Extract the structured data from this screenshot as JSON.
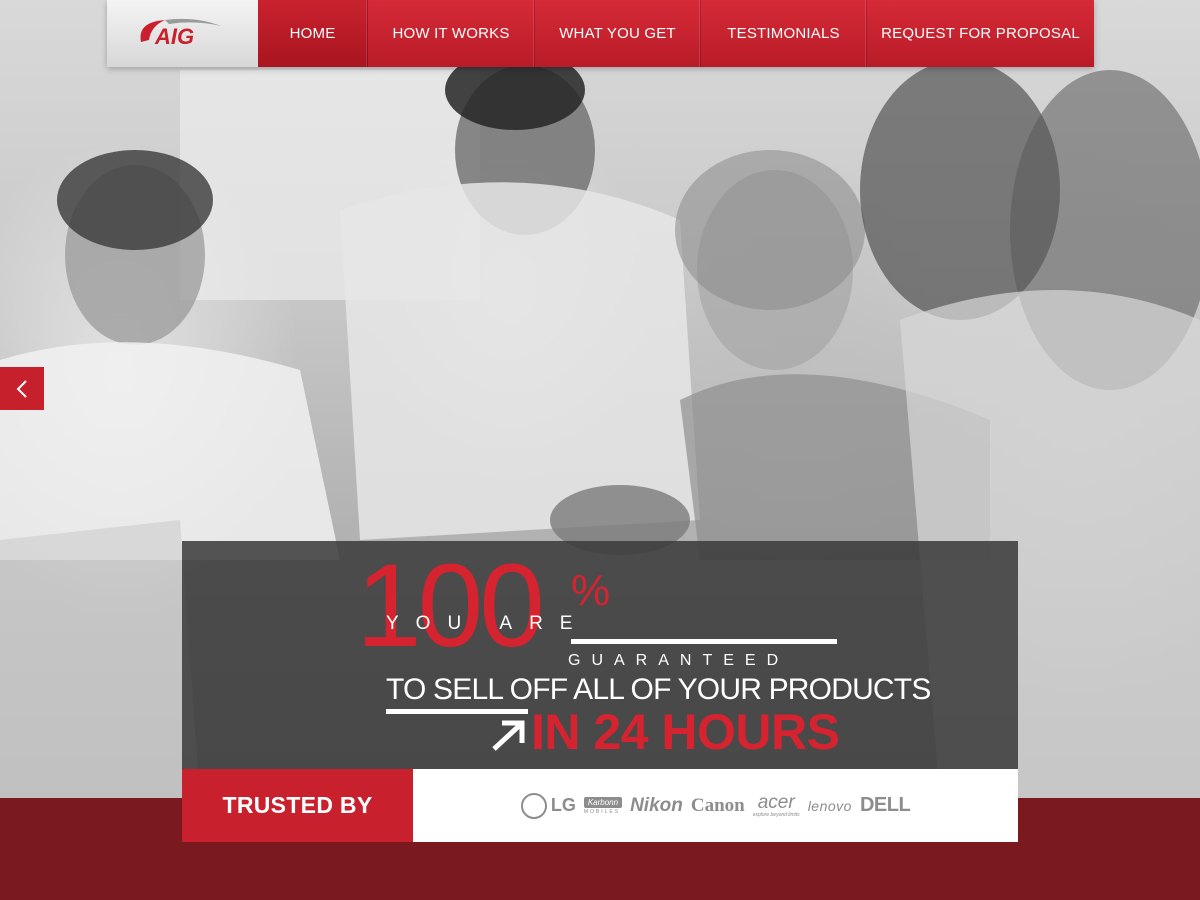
{
  "nav": {
    "logo_text": "AIG",
    "items": [
      {
        "label": "HOME",
        "active": true
      },
      {
        "label": "HOW IT WORKS",
        "active": false
      },
      {
        "label": "WHAT YOU GET",
        "active": false
      },
      {
        "label": "TESTIMONIALS",
        "active": false
      },
      {
        "label": "REQUEST FOR PROPOSAL",
        "active": false
      }
    ]
  },
  "slider": {
    "prev_icon": "chevron-left-icon"
  },
  "promo": {
    "big_number": "100",
    "percent_sign": "%",
    "you_are": "YOU ARE",
    "guaranteed": "GUARANTEED",
    "sell_off": "TO SELL OFF ALL OF YOUR PRODUCTS",
    "headline": "IN 24 HOURS",
    "arrow_icon": "arrow-up-right-icon"
  },
  "trusted": {
    "label": "TRUSTED BY",
    "brands": {
      "lg": "LG",
      "karbonn": "Karbonn",
      "karbonn_tag": "MOBILES",
      "nikon": "Nikon",
      "canon": "Canon",
      "acer": "acer",
      "acer_tag": "explore beyond limits",
      "lenovo": "lenovo",
      "dell": "DELL"
    }
  },
  "colors": {
    "brand_red": "#c9202d",
    "accent_red": "#d5232f",
    "footer_maroon": "#7a1a1f",
    "promo_bg": "#3a3a3a"
  }
}
